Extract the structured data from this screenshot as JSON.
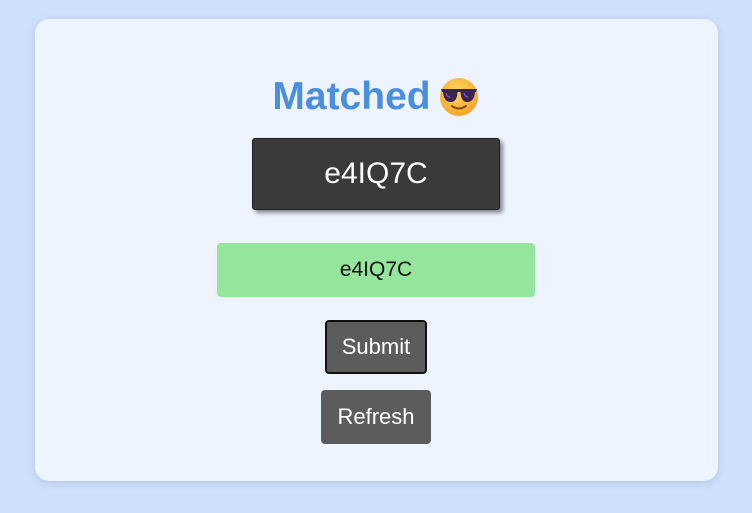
{
  "status": {
    "title": "Matched",
    "emoji": "smiling-face-with-sunglasses-icon"
  },
  "captcha": {
    "text": "e4IQ7C"
  },
  "answer": {
    "value": "e4IQ7C"
  },
  "buttons": {
    "submit_label": "Submit",
    "refresh_label": "Refresh"
  },
  "colors": {
    "page_background": "#cfe0fb",
    "card_background": "#eef4ff",
    "title": "#4a8ee0",
    "captcha_background": "#3a3a3a",
    "matched_input_background": "#95e59c",
    "button_background": "#5c5c5c"
  }
}
